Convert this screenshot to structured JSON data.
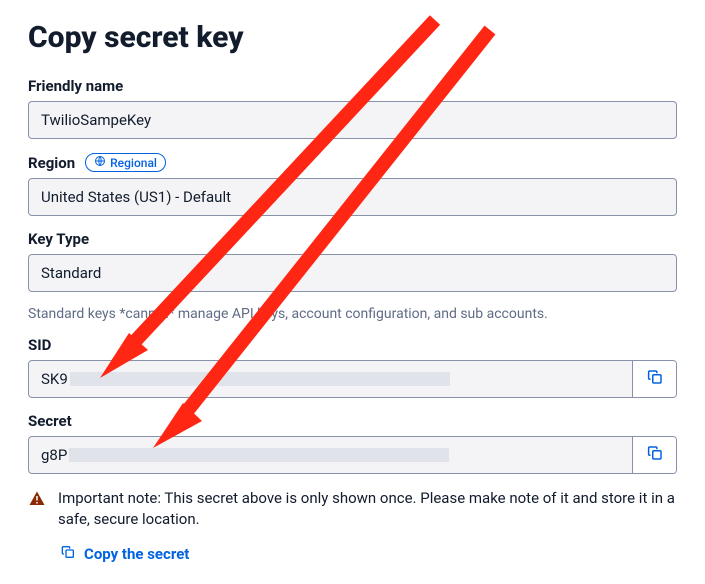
{
  "title": "Copy secret key",
  "fields": {
    "friendly_name": {
      "label": "Friendly name",
      "value": "TwilioSampeKey"
    },
    "region": {
      "label": "Region",
      "badge": "Regional",
      "value": "United States (US1) - Default"
    },
    "key_type": {
      "label": "Key Type",
      "value": "Standard",
      "helper": "Standard keys *cannot* manage API keys, account configuration, and sub accounts."
    },
    "sid": {
      "label": "SID",
      "value": "SK9"
    },
    "secret": {
      "label": "Secret",
      "value": "g8P"
    }
  },
  "note": "Important note: This secret above is only shown once. Please make note of it and store it in a safe, secure location.",
  "copy_secret_label": "Copy the secret"
}
